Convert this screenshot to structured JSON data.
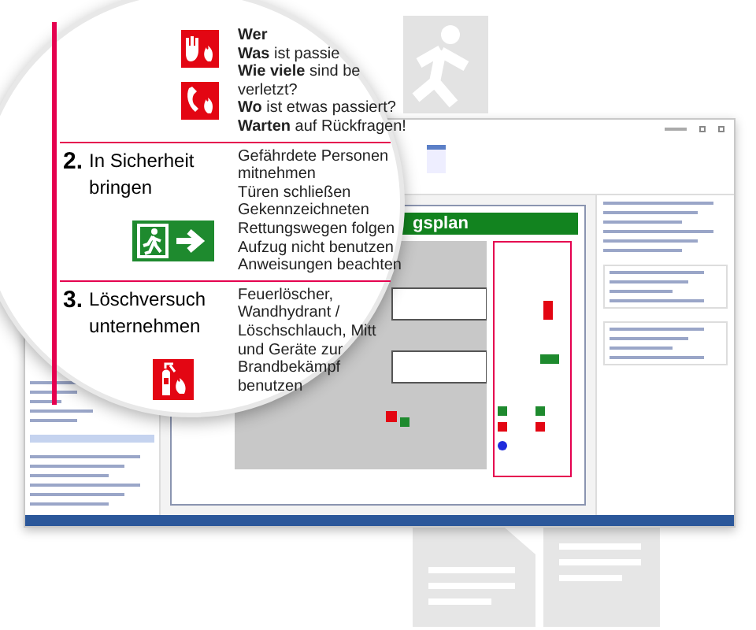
{
  "magnifier": {
    "steps": [
      {
        "icons": [
          {
            "kind": "hand-fire"
          },
          {
            "kind": "phone-fire"
          }
        ],
        "lines": [
          "**Wer**",
          "**Was** ist passie",
          "**Wie viele** sind be",
          "verletzt?",
          "**Wo** ist etwas passiert?",
          "**Warten** auf Rückfragen!"
        ]
      },
      {
        "number": "2.",
        "title": "In Sicherheit bringen",
        "icons": [
          {
            "kind": "exit"
          }
        ],
        "lines": [
          "Gefährdete Personen",
          "mitnehmen",
          "Türen schließen",
          "Gekennzeichneten",
          "Rettungswegen folgen",
          "Aufzug nicht benutzen",
          "Anweisungen beachten"
        ]
      },
      {
        "number": "3.",
        "title": "Löschversuch unternehmen",
        "icons": [
          {
            "kind": "extinguisher"
          }
        ],
        "lines": [
          "Feuerlöscher,",
          "Wandhydrant /",
          "Löschschlauch, Mitt",
          "und Geräte zur",
          "Brandbekämpf",
          "benutzen"
        ]
      }
    ]
  },
  "app": {
    "plan_title": "gsplan"
  }
}
